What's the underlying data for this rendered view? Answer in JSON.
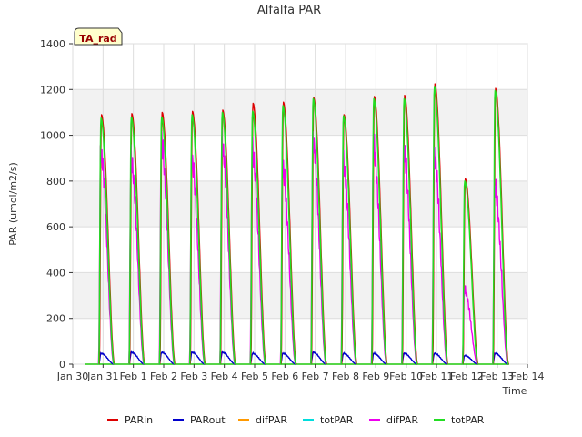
{
  "chart_data": {
    "type": "line",
    "title": "Alfalfa PAR",
    "xlabel": "Time",
    "ylabel": "PAR (umol/m2/s)",
    "badge": "TA_rad",
    "ylim": [
      0,
      1400
    ],
    "yticks": [
      0,
      200,
      400,
      600,
      800,
      1000,
      1200,
      1400
    ],
    "xlim": [
      0,
      15
    ],
    "xticks": [
      {
        "x": 0,
        "label": "Jan 30"
      },
      {
        "x": 1,
        "label": "Jan 31"
      },
      {
        "x": 2,
        "label": "Feb 1"
      },
      {
        "x": 3,
        "label": "Feb 2"
      },
      {
        "x": 4,
        "label": "Feb 3"
      },
      {
        "x": 5,
        "label": "Feb 4"
      },
      {
        "x": 6,
        "label": "Feb 5"
      },
      {
        "x": 7,
        "label": "Feb 6"
      },
      {
        "x": 8,
        "label": "Feb 7"
      },
      {
        "x": 9,
        "label": "Feb 8"
      },
      {
        "x": 10,
        "label": "Feb 9"
      },
      {
        "x": 11,
        "label": "Feb 10"
      },
      {
        "x": 12,
        "label": "Feb 11"
      },
      {
        "x": 13,
        "label": "Feb 12"
      },
      {
        "x": 14,
        "label": "Feb 13"
      },
      {
        "x": 15,
        "label": "Feb 14"
      }
    ],
    "grid": true,
    "legend_position": "bottom",
    "day_peaks": [
      {
        "day": 0,
        "parin": 1090,
        "parout": 50,
        "totpar": 1075,
        "difpar": 1000
      },
      {
        "day": 1,
        "parin": 1095,
        "parout": 55,
        "totpar": 1080,
        "difpar": 960
      },
      {
        "day": 2,
        "parin": 1100,
        "parout": 55,
        "totpar": 1080,
        "difpar": 1040
      },
      {
        "day": 3,
        "parin": 1105,
        "parout": 55,
        "totpar": 1090,
        "difpar": 960
      },
      {
        "day": 4,
        "parin": 1110,
        "parout": 55,
        "totpar": 1100,
        "difpar": 1040
      },
      {
        "day": 5,
        "parin": 1140,
        "parout": 50,
        "totpar": 1105,
        "difpar": 1000
      },
      {
        "day": 6,
        "parin": 1145,
        "parout": 50,
        "totpar": 1130,
        "difpar": 920
      },
      {
        "day": 7,
        "parin": 1165,
        "parout": 55,
        "totpar": 1160,
        "difpar": 1050
      },
      {
        "day": 8,
        "parin": 1090,
        "parout": 50,
        "totpar": 1085,
        "difpar": 950
      },
      {
        "day": 9,
        "parin": 1170,
        "parout": 50,
        "totpar": 1160,
        "difpar": 1020
      },
      {
        "day": 10,
        "parin": 1175,
        "parout": 50,
        "totpar": 1160,
        "difpar": 1000
      },
      {
        "day": 11,
        "parin": 1225,
        "parout": 50,
        "totpar": 1210,
        "difpar": 980
      },
      {
        "day": 12,
        "parin": 810,
        "parout": 40,
        "totpar": 800,
        "difpar": 350
      },
      {
        "day": 13,
        "parin": 1205,
        "parout": 50,
        "totpar": 1195,
        "difpar": 830
      }
    ],
    "series": [
      {
        "name": "PARin",
        "color": "#dd0000"
      },
      {
        "name": "PARout",
        "color": "#0000cc"
      },
      {
        "name": "difPAR",
        "color": "#ff9900"
      },
      {
        "name": "totPAR",
        "color": "#00dddd"
      },
      {
        "name": "difPAR",
        "color": "#ee00ee"
      },
      {
        "name": "totPAR",
        "color": "#22dd22"
      }
    ]
  }
}
